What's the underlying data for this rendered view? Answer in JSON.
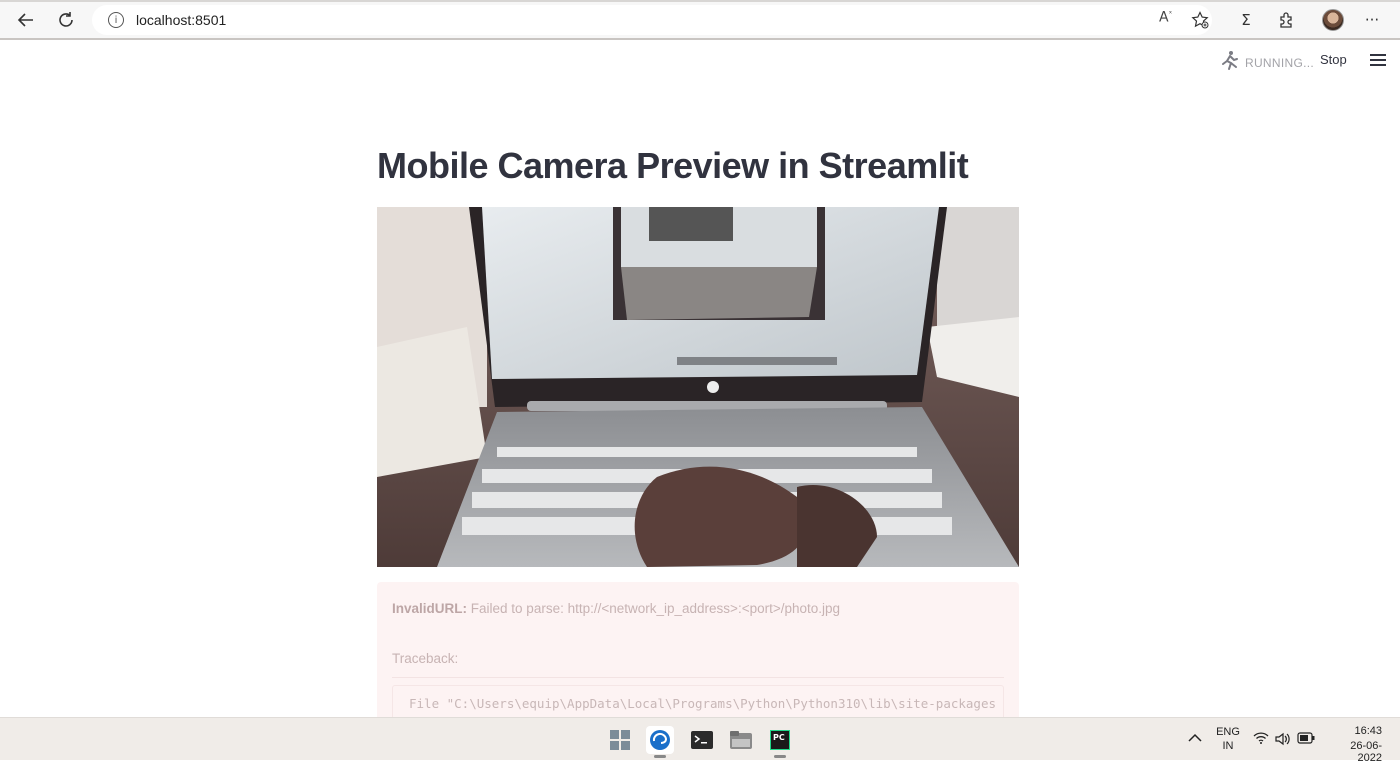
{
  "browser": {
    "url": "localhost:8501",
    "icons": [
      "back-arrow-icon",
      "refresh-icon",
      "info-icon",
      "read-aloud-icon",
      "add-favorite-icon",
      "math-solver-icon",
      "extensions-icon",
      "profile-avatar",
      "more-options-icon"
    ],
    "read_aloud_glyph": "A",
    "math_glyph": "Σ",
    "more_glyph": "···"
  },
  "streamlit": {
    "status_text": "RUNNING...",
    "stop_label": "Stop",
    "title": "Mobile Camera Preview in Streamlit"
  },
  "error": {
    "exception_type": "InvalidURL:",
    "message": "Failed to parse: http://<network_ip_address>:<port>/photo.jpg",
    "traceback_label": "Traceback:",
    "code_line": "File \"C:\\Users\\equip\\AppData\\Local\\Programs\\Python\\Python310\\lib\\site-packages"
  },
  "taskbar": {
    "apps": [
      "windows-start-icon",
      "edge-browser-icon",
      "terminal-icon",
      "file-explorer-icon",
      "pycharm-icon"
    ],
    "pycharm_glyph": "PC",
    "language_line1": "ENG",
    "language_line2": "IN",
    "time": "16:43",
    "date": "26-06-2022",
    "colors": {
      "taskbar_bg": "#f0ece8",
      "edge_blue": "#1a6fc9",
      "pycharm_green": "#21d789"
    }
  }
}
